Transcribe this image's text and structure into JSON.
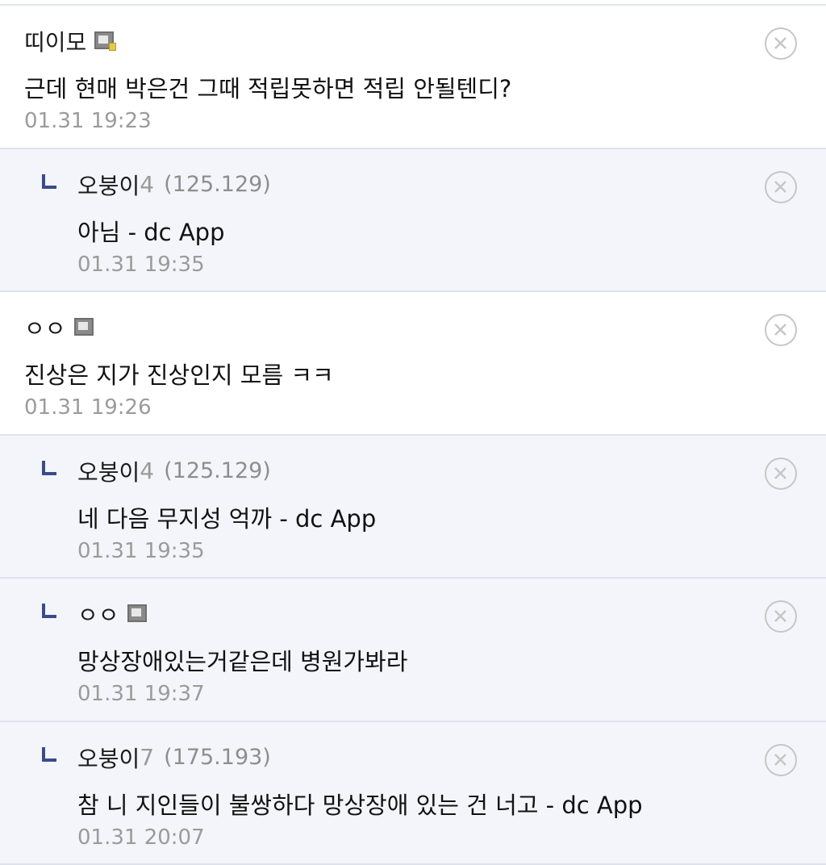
{
  "comments": [
    {
      "reply": false,
      "author": "띠이모",
      "author_suffix": "",
      "ip": "",
      "badge": "fixed-user-badge-icon",
      "body": "근데 현매 박은건 그때 적립못하면 적립 안될텐디?",
      "time": "01.31 19:23"
    },
    {
      "reply": true,
      "author": "오붕이",
      "author_suffix": "4",
      "ip": "(125.129)",
      "badge": "",
      "body": "아님 - dc App",
      "time": "01.31 19:35"
    },
    {
      "reply": false,
      "author": "ㅇㅇ",
      "author_suffix": "",
      "ip": "",
      "badge": "semi-fixed-user-badge-icon",
      "body": "진상은 지가 진상인지 모름 ㅋㅋ",
      "time": "01.31 19:26"
    },
    {
      "reply": true,
      "author": "오붕이",
      "author_suffix": "4",
      "ip": "(125.129)",
      "badge": "",
      "body": "네 다음 무지성 억까 - dc App",
      "time": "01.31 19:35"
    },
    {
      "reply": true,
      "author": "ㅇㅇ",
      "author_suffix": "",
      "ip": "",
      "badge": "semi-fixed-user-badge-icon",
      "body": "망상장애있는거같은데 병원가봐라",
      "time": "01.31 19:37"
    },
    {
      "reply": true,
      "author": "오붕이",
      "author_suffix": "7",
      "ip": "(175.193)",
      "badge": "",
      "body": "참 니 지인들이 불쌍하다 망상장애 있는 건 너고 - dc App",
      "time": "01.31 20:07"
    }
  ],
  "colors": {
    "reply_background": "#f3f5fa",
    "reply_arrow": "#3b4a8a",
    "timestamp": "#9b9b9b",
    "ip": "#8e8e8e"
  },
  "icons": {
    "reply": "reply-arrow-icon",
    "delete": "delete-circle-x-icon"
  }
}
